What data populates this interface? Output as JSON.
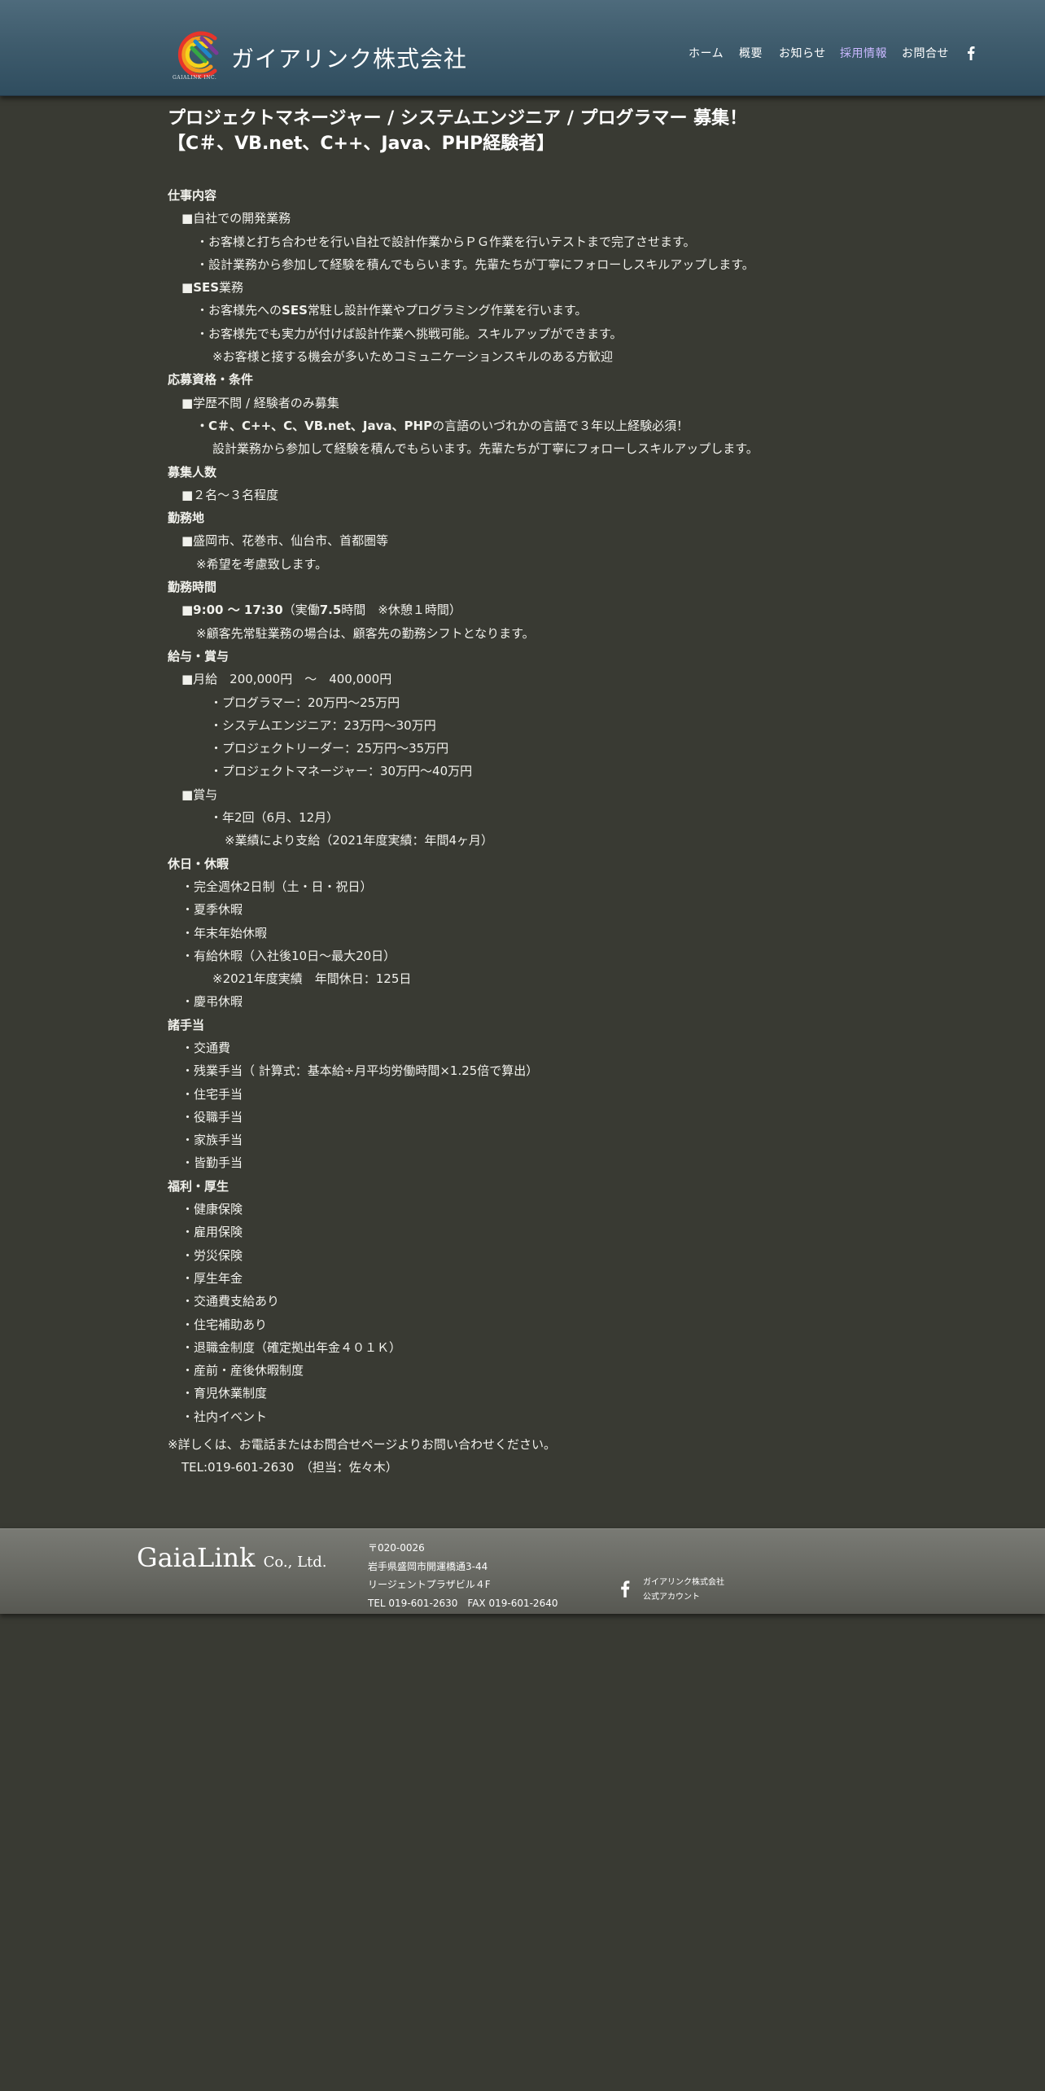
{
  "brand": {
    "logo_icon": "gaialink-rainbow-c-logo-icon",
    "logo_subtext": "GAIALINK INC.",
    "company_name": "ガイアリンク株式会社",
    "accent_colors": [
      "#e7352b",
      "#f39a1e",
      "#f6d31a",
      "#35a845",
      "#1f86c8",
      "#7b3a96"
    ]
  },
  "nav": {
    "items": [
      {
        "label": "ホーム"
      },
      {
        "label": "概要"
      },
      {
        "label": "お知らせ"
      },
      {
        "label": "採用情報"
      },
      {
        "label": "お問合せ"
      }
    ],
    "active": "採用情報",
    "active_color": "#c9b8ff",
    "social_icon": "facebook-icon"
  },
  "page": {
    "title_line1": "プロジェクトマネージャー / システムエンジニア / プログラマー 募集！",
    "title_line2": "【C＃、VB.net、C++、Java、PHP経験者】"
  },
  "sections": {
    "job": {
      "heading": "仕事内容",
      "sub1": "■自社での開発業務",
      "line1": "・お客様と打ち合わせを行い自社で設計作業からＰＧ作業を行いテストまで完了させます。",
      "line2": "・設計業務から参加して経験を積んでもらいます。先輩たちが丁寧にフォローしスキルアップします。",
      "sub2_mark": "■",
      "sub2_bold": "SES",
      "sub2_rest": "業務",
      "line3_pre": "・お客様先への",
      "line3_bold": "SES",
      "line3_post": "常駐し設計作業やプログラミング作業を行います。",
      "line4": "・お客様先でも実力が付けば設計作業へ挑戦可能。スキルアップができます。",
      "line5": "※お客様と接する機会が多いためコミュニケーションスキルのある方歓迎"
    },
    "qualification": {
      "heading": "応募資格・条件",
      "sub1": "■学歴不問 / 経験者のみ募集",
      "line1_bold": "・C＃、C++、C、VB.net、Java、PHP",
      "line1_rest": "の言語のいづれかの言語で３年以上経験必須！",
      "line2": "設計業務から参加して経験を積んでもらいます。先輩たちが丁寧にフォローしスキルアップします。"
    },
    "headcount": {
      "heading": "募集人数",
      "line1": "■２名～３名程度"
    },
    "location": {
      "heading": "勤務地",
      "line1": "■盛岡市、花巻市、仙台市、首都圏等",
      "line2": "※希望を考慮致します。"
    },
    "hours": {
      "heading": "勤務時間",
      "line1_bold": "■9:00 ～ 17:30",
      "line1_rest": "（実働",
      "line1_bold2": "7.5",
      "line1_rest2": "時間　※休憩１時間）",
      "line2": "※顧客先常駐業務の場合は、顧客先の勤務シフトとなります。"
    },
    "salary": {
      "heading": "給与・賞与",
      "monthly": "■月給　200,000円　～　400,000円",
      "ranks": [
        "・プログラマー：20万円～25万円",
        "・システムエンジニア：23万円～30万円",
        "・プロジェクトリーダー：25万円～35万円",
        "・プロジェクトマネージャー：30万円～40万円"
      ],
      "bonus_label": "■賞与",
      "bonus_line": "・年2回（6月、12月）",
      "bonus_note": "※業績により支給（2021年度実績：年間4ヶ月）"
    },
    "holidays": {
      "heading": "休日・休暇",
      "items": [
        "・完全週休2日制（土・日・祝日）",
        "・夏季休暇",
        "・年末年始休暇",
        "・有給休暇（入社後10日～最大20日）"
      ],
      "note": "※2021年度実績　年間休日：125日",
      "last": "・慶弔休暇"
    },
    "allowances": {
      "heading": "諸手当",
      "items": [
        "・交通費",
        "・残業手当（ 計算式：基本給÷月平均労働時間×1.25倍で算出）",
        "・住宅手当",
        "・役職手当",
        "・家族手当",
        "・皆勤手当"
      ]
    },
    "welfare": {
      "heading": "福利・厚生",
      "items": [
        "・健康保険",
        "・雇用保険",
        "・労災保険",
        "・厚生年金",
        "・交通費支給あり",
        "・住宅補助あり",
        "・退職金制度（確定拠出年金４０１Ｋ）",
        "・産前・産後休暇制度",
        "・育児休業制度",
        "・社内イベント"
      ]
    }
  },
  "contact": {
    "note": "※詳しくは、お電話またはお問合せページよりお問い合わせください。",
    "tel": "TEL:019-601-2630　（担当：佐々木）"
  },
  "footer": {
    "logo_main": "GaiaLink",
    "logo_sub": "Co., Ltd.",
    "address": {
      "postal": "〒020-0026",
      "line1": "岩手県盛岡市開運橋通3-44",
      "line2": "リージェントプラザビル４F",
      "tel_fax": "TEL 019-601-2630　FAX 019-601-2640"
    },
    "fb_icon": "facebook-icon",
    "fb_line1": "ガイアリンク株式会社",
    "fb_line2": "公式アカウント"
  }
}
